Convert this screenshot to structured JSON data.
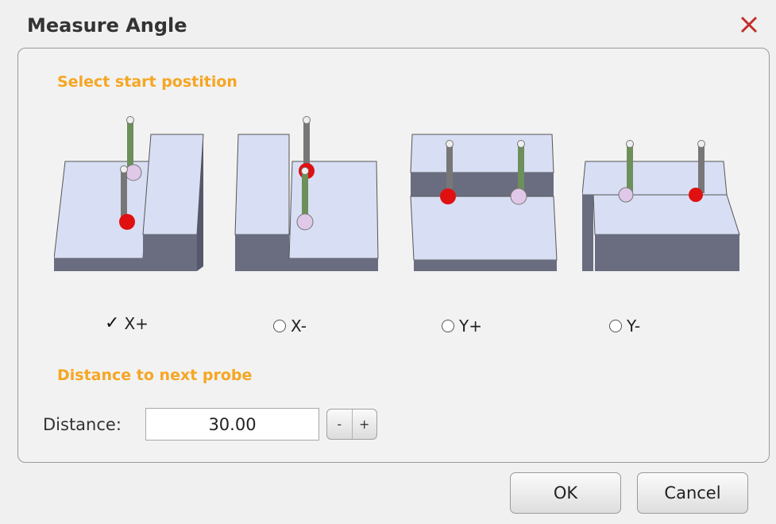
{
  "dialog": {
    "title": "Measure Angle",
    "close_icon": "close-icon"
  },
  "start_section": {
    "title": "Select start postition"
  },
  "options": [
    {
      "label": "X+",
      "selected": true
    },
    {
      "label": "X-",
      "selected": false
    },
    {
      "label": "Y+",
      "selected": false
    },
    {
      "label": "Y-",
      "selected": false
    }
  ],
  "distance_section": {
    "title": "Distance to next probe",
    "label": "Distance:",
    "value": "30.00",
    "minus": "-",
    "plus": "+"
  },
  "buttons": {
    "ok": "OK",
    "cancel": "Cancel"
  },
  "colors": {
    "accent": "#f5a623",
    "close": "#c0302a",
    "block_top": "#d9e0f5",
    "block_side": "#6b6e80"
  }
}
